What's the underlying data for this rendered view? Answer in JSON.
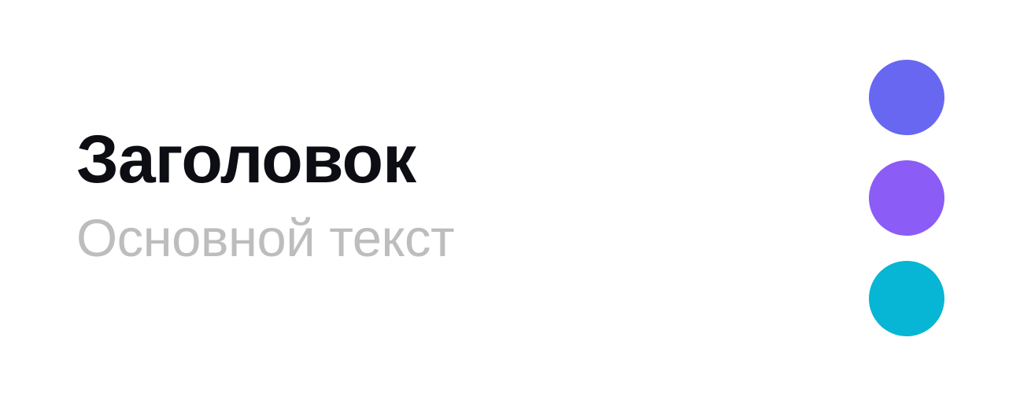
{
  "heading": "Заголовок",
  "body_text": "Основной текст",
  "colors": {
    "heading": "#0d0d14",
    "body_text": "#bdbdbd",
    "background": "#ffffff"
  },
  "swatches": [
    {
      "color": "#6767f1"
    },
    {
      "color": "#8b5cf6"
    },
    {
      "color": "#06b6d4"
    }
  ]
}
